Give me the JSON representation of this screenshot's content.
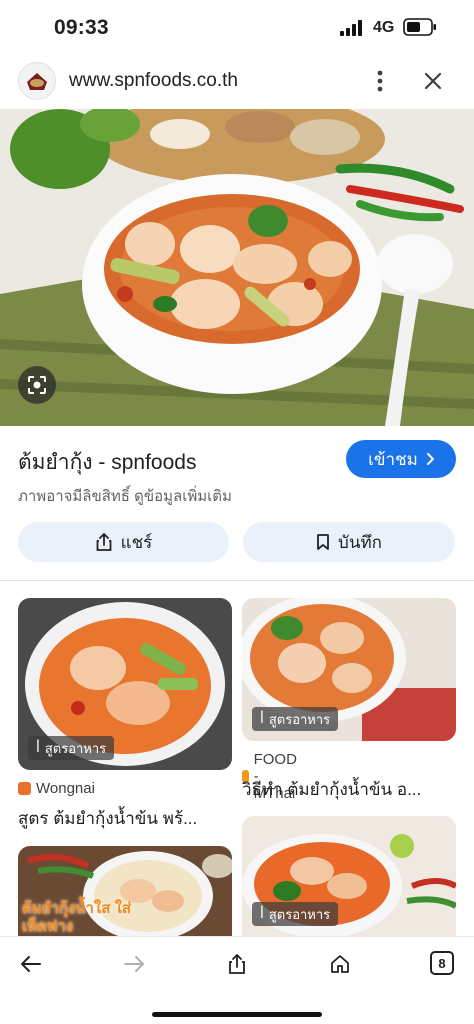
{
  "status_bar": {
    "time": "09:33",
    "network": "4G"
  },
  "url_bar": {
    "url": "www.spnfoods.co.th"
  },
  "result": {
    "title": "ต้มยำกุ้ง - spnfoods",
    "visit_label": "เข้าชม",
    "subtitle": "ภาพอาจมีลิขสิทธิ์ ดูข้อมูลเพิ่มเติม",
    "share_label": "แชร์",
    "save_label": "บันทึก"
  },
  "related": [
    {
      "chip": "สูตรอาหาร",
      "source": "Wongnai",
      "title": "สูตร ต้มยำกุ้งน้ำข้น พร้..."
    },
    {
      "chip": "สูตรอาหาร",
      "source": "FOOD - MThai",
      "title": "วิธีทำ ต้มยำกุ้งน้ำข้น อ..."
    },
    {
      "chip": "",
      "overlay_text": "ต้มยำกุ้งน้ำใส ใส่เห็ดฟาง"
    },
    {
      "chip": "สูตรอาหาร"
    }
  ],
  "bottom_bar": {
    "tab_count": "8"
  },
  "colors": {
    "accent": "#1a73e8",
    "pill_bg": "#eaf1fb"
  }
}
